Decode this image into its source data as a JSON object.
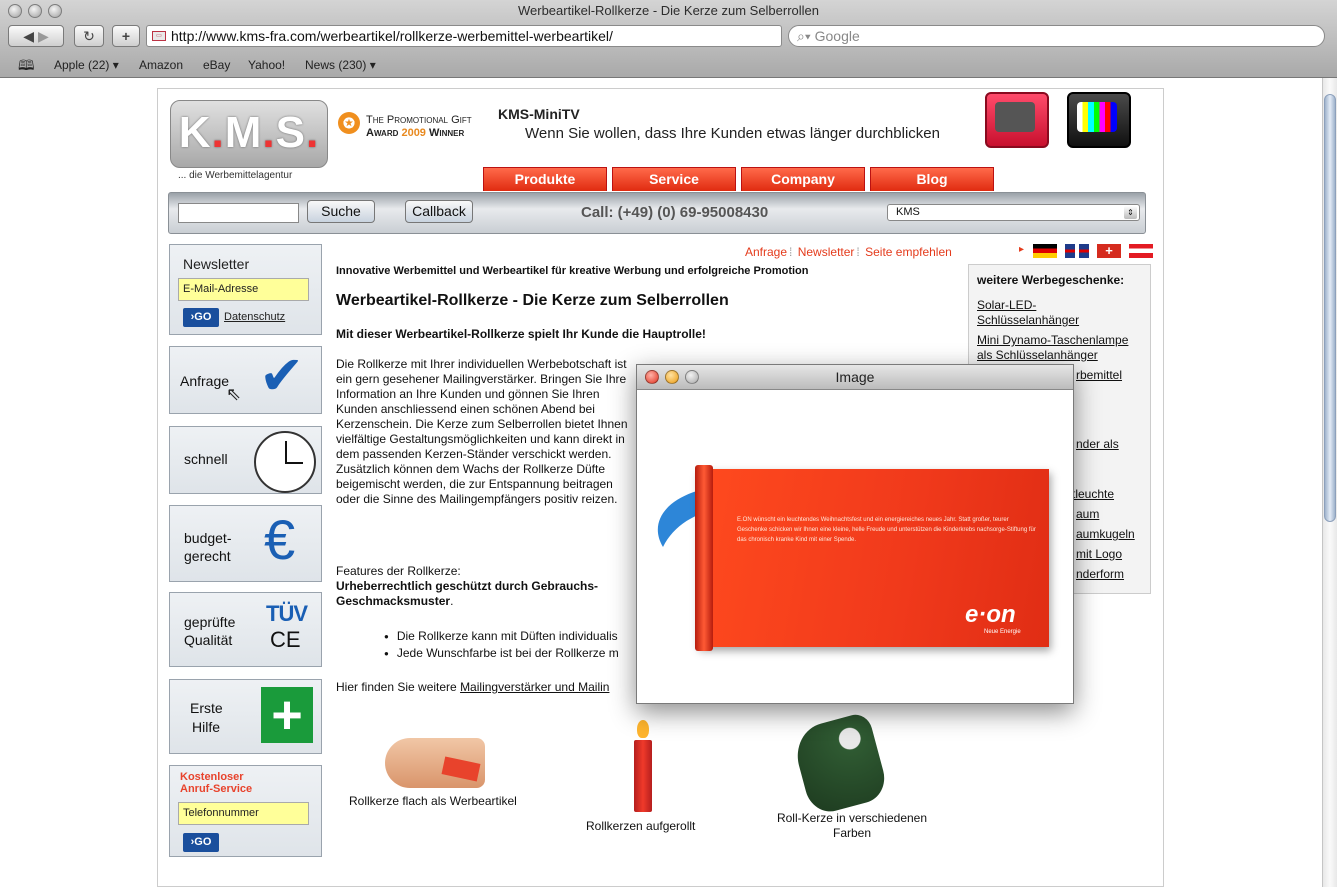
{
  "browser": {
    "window_title": "Werbeartikel-Rollkerze - Die Kerze zum Selberrollen",
    "url": "http://www.kms-fra.com/werbeartikel/rollkerze-werbemittel-werbeartikel/",
    "search_placeholder": "Google",
    "bookmarks": [
      "Apple (22) ▾",
      "Amazon",
      "eBay",
      "Yahoo!",
      "News (230) ▾"
    ]
  },
  "header": {
    "logo_text": "K.M.S.",
    "tagline": "... die Werbemittelagentur",
    "award_line1": "The Promotional Gift",
    "award_line2_pre": "Award ",
    "award_year": "2009",
    "award_line2_post": " Winner",
    "mini_title": "KMS-MiniTV",
    "mini_subtitle": "Wenn Sie wollen, dass Ihre Kunden etwas länger durchblicken"
  },
  "nav": {
    "tabs": [
      "Produkte",
      "Service",
      "Company",
      "Blog"
    ]
  },
  "searchbar": {
    "search_button": "Suche",
    "callback_button": "Callback",
    "call_info": "Call: (+49) (0) 69-95008430",
    "select_value": "KMS"
  },
  "sidebar": {
    "newsletter_title": "Newsletter",
    "email_placeholder": "E-Mail-Adresse",
    "go_label": "›GO",
    "privacy_link": "Datenschutz",
    "anfrage": "Anfrage",
    "schnell": "schnell",
    "budget_line1": "budget-",
    "budget_line2": "gerecht",
    "quality_line1": "geprüfte",
    "quality_line2": "Qualität",
    "tuv": "TÜV",
    "ce": "CE",
    "firstaid_line1": "Erste",
    "firstaid_line2": "Hilfe",
    "freecall_line1": "Kostenloser",
    "freecall_line2": "Anruf-Service",
    "phone_placeholder": "Telefonnummer"
  },
  "content": {
    "top_links": [
      "Anfrage",
      "Newsletter",
      "Seite empfehlen"
    ],
    "intro": "Innovative Werbemittel und Werbeartikel für kreative Werbung und erfolgreiche Promotion",
    "headline": "Werbeartikel-Rollkerze - Die Kerze zum Selberrollen",
    "lead": "Mit dieser Werbeartikel-Rollkerze spielt Ihr Kunde die Hauptrolle!",
    "body": "Die Rollkerze mit Ihrer individuellen Werbebotschaft ist ein gern gesehener Mailingverstärker. Bringen Sie Ihre Information an Ihre Kunden und gönnen Sie Ihren Kunden anschliessend einen schönen Abend bei Kerzenschein. Die Kerze zum Selberrollen bietet Ihnen vielfältige Gestaltungsmöglichkeiten und kann direkt in dem passenden Kerzen-Ständer verschickt werden. Zusätzlich können dem Wachs der Rollkerze Düfte beigemischt werden, die zur Entspannung beitragen oder die Sinne des Mailingempfängers positiv reizen.",
    "features_title": "Features der Rollkerze:",
    "features_bold": "Urheberrechtlich geschützt durch Gebrauchs- Geschmacksmuster",
    "features_bold_suffix": ".",
    "bullets": [
      "Die Rollkerze kann mit Düften individualis",
      "Jede Wunschfarbe ist bei der Rollkerze m"
    ],
    "more_prefix": "Hier finden Sie weitere ",
    "more_link": "Mailingverstärker und Mailin"
  },
  "right_sidebar": {
    "title": "weitere Werbegeschenke:",
    "links": [
      "Solar-LED-",
      "Schlüsselanhänger",
      "Mini Dynamo-Taschenlampe",
      "als Schlüsselanhänger",
      "rbemittel",
      "nder als",
      "tleuchte",
      "aum",
      "aumkugeln",
      "mit Logo",
      "nderform"
    ]
  },
  "products": [
    {
      "label": "Rollkerze flach als Werbeartikel"
    },
    {
      "label": "Rollkerzen aufgerollt"
    },
    {
      "label_line1": "Roll-Kerze in verschiedenen",
      "label_line2": "Farben"
    }
  ],
  "image_window": {
    "title": "Image",
    "card_text": "E.ON wünscht ein leuchtendes Weihnachtsfest und ein energiereiches neues Jahr. Statt großer, teurer Geschenke schicken wir Ihnen eine kleine, helle Freude und unterstützen die Kinderkrebs nachsorge-Stiftung für das chronisch kranke Kind mit einer Spende.",
    "brand": "e·on",
    "brand_sub": "Neue Energie"
  },
  "colors": {
    "accent_red": "#e8432c",
    "nav_red": "#f0391b",
    "brand_blue": "#1a5fb4",
    "input_yellow": "#ffff99",
    "firstaid_green": "#1a9b3b"
  }
}
